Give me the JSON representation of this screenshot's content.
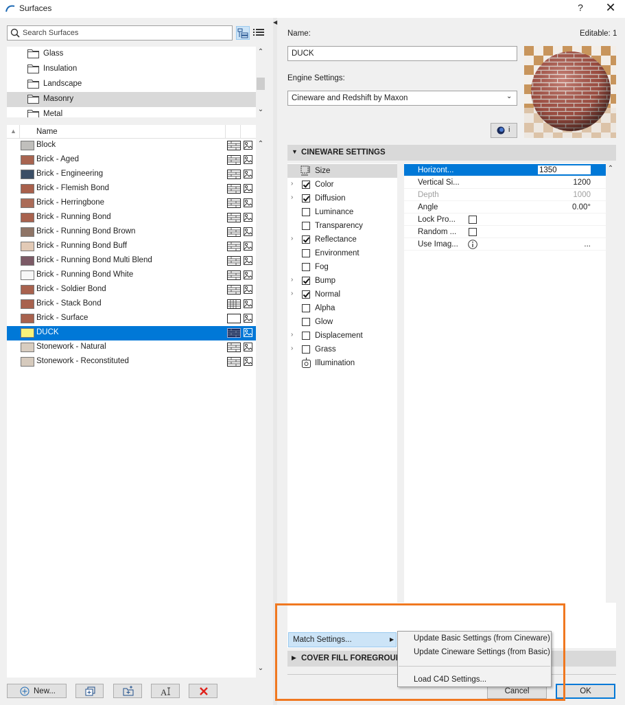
{
  "window": {
    "title": "Surfaces",
    "help": "?",
    "close": "✕"
  },
  "search": {
    "placeholder": "Search Surfaces"
  },
  "folders": [
    {
      "label": "Glass",
      "selected": false
    },
    {
      "label": "Insulation",
      "selected": false
    },
    {
      "label": "Landscape",
      "selected": false
    },
    {
      "label": "Masonry",
      "selected": true
    },
    {
      "label": "Metal",
      "selected": false
    }
  ],
  "list": {
    "header": "Name",
    "rows": [
      {
        "label": "Block",
        "color": "#c0bfbc",
        "selected": false
      },
      {
        "label": "Brick - Aged",
        "color": "#a86450",
        "selected": false
      },
      {
        "label": "Brick - Engineering",
        "color": "#3b4e66",
        "selected": false
      },
      {
        "label": "Brick - Flemish Bond",
        "color": "#a8604c",
        "selected": false
      },
      {
        "label": "Brick - Herringbone",
        "color": "#ab6c58",
        "selected": false
      },
      {
        "label": "Brick - Running Bond",
        "color": "#a8624e",
        "selected": false
      },
      {
        "label": "Brick - Running Bond Brown",
        "color": "#8e7466",
        "selected": false
      },
      {
        "label": "Brick - Running Bond Buff",
        "color": "#e2cab6",
        "selected": false
      },
      {
        "label": "Brick - Running Bond Multi Blend",
        "color": "#7c5a66",
        "selected": false
      },
      {
        "label": "Brick - Running Bond White",
        "color": "#f6f6f6",
        "selected": false
      },
      {
        "label": "Brick - Soldier Bond",
        "color": "#a8624e",
        "selected": false
      },
      {
        "label": "Brick - Stack Bond",
        "color": "#a8624e",
        "selected": false
      },
      {
        "label": "Brick - Surface",
        "color": "#a8624e",
        "selected": false
      },
      {
        "label": "DUCK",
        "color": "#f7f27a",
        "selected": true
      },
      {
        "label": "Stonework - Natural",
        "color": "#d8cdc0",
        "selected": false
      },
      {
        "label": "Stonework - Reconstituted",
        "color": "#d6cabd",
        "selected": false
      }
    ]
  },
  "bottom_buttons": {
    "new": "New..."
  },
  "name_field": {
    "label": "Name:",
    "value": "DUCK",
    "editable": "Editable: 1"
  },
  "engine": {
    "label": "Engine Settings:",
    "value": "Cineware and Redshift by Maxon"
  },
  "info_button": "i",
  "section1": "CINEWARE SETTINGS",
  "channels": [
    {
      "label": "Size",
      "checked": null,
      "expand": false,
      "selected": true
    },
    {
      "label": "Color",
      "checked": true,
      "expand": true,
      "selected": false
    },
    {
      "label": "Diffusion",
      "checked": true,
      "expand": true,
      "selected": false
    },
    {
      "label": "Luminance",
      "checked": false,
      "expand": false,
      "selected": false
    },
    {
      "label": "Transparency",
      "checked": false,
      "expand": false,
      "selected": false
    },
    {
      "label": "Reflectance",
      "checked": true,
      "expand": true,
      "selected": false
    },
    {
      "label": "Environment",
      "checked": false,
      "expand": false,
      "selected": false
    },
    {
      "label": "Fog",
      "checked": false,
      "expand": false,
      "selected": false
    },
    {
      "label": "Bump",
      "checked": true,
      "expand": true,
      "selected": false
    },
    {
      "label": "Normal",
      "checked": true,
      "expand": true,
      "selected": false
    },
    {
      "label": "Alpha",
      "checked": false,
      "expand": false,
      "selected": false
    },
    {
      "label": "Glow",
      "checked": false,
      "expand": false,
      "selected": false
    },
    {
      "label": "Displacement",
      "checked": false,
      "expand": true,
      "selected": false
    },
    {
      "label": "Grass",
      "checked": false,
      "expand": true,
      "selected": false
    },
    {
      "label": "Illumination",
      "checked": null,
      "expand": false,
      "selected": false
    }
  ],
  "properties": [
    {
      "name": "Horizont...",
      "value": "1350",
      "kind": "input",
      "selected": true
    },
    {
      "name": "Vertical Si...",
      "value": "1200",
      "kind": "text",
      "selected": false
    },
    {
      "name": "Depth",
      "value": "1000",
      "kind": "disabled",
      "selected": false
    },
    {
      "name": "Angle",
      "value": "0.00°",
      "kind": "text",
      "selected": false
    },
    {
      "name": "Lock Pro...",
      "value": "",
      "kind": "check",
      "selected": false
    },
    {
      "name": "Random ...",
      "value": "",
      "kind": "check",
      "selected": false
    },
    {
      "name": "Use Imag...",
      "value": "...",
      "kind": "info",
      "selected": false
    }
  ],
  "match_settings": "Match Settings...",
  "section2": "COVER FILL FOREGROUND",
  "menu": {
    "items": [
      "Update Basic Settings (from Cineware)",
      "Update Cineware Settings (from Basic)",
      "Load C4D Settings..."
    ]
  },
  "cancel": "Cancel",
  "ok": "OK",
  "colors": {
    "accent": "#0078d7",
    "highlight": "#f07820"
  }
}
